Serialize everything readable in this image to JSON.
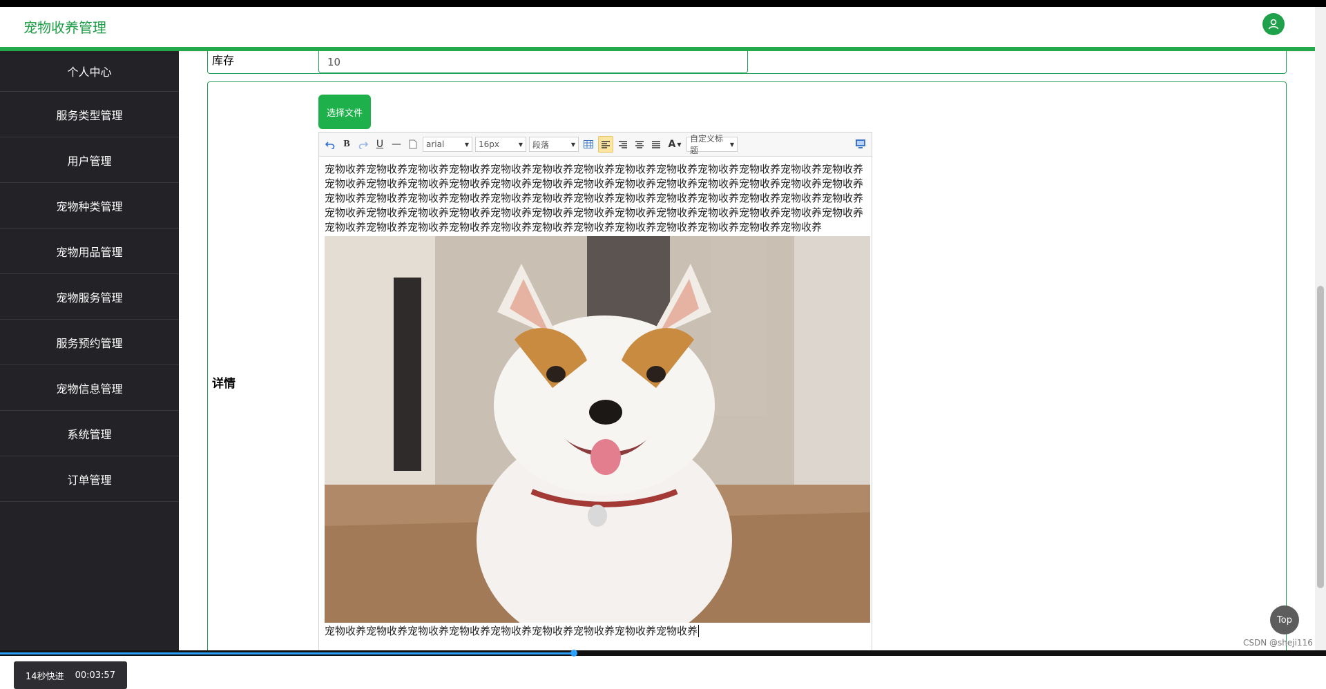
{
  "header": {
    "title": "宠物收养管理"
  },
  "sidebar": {
    "items": [
      {
        "label": "个人中心"
      },
      {
        "label": "服务类型管理"
      },
      {
        "label": "用户管理"
      },
      {
        "label": "宠物种类管理"
      },
      {
        "label": "宠物用品管理"
      },
      {
        "label": "宠物服务管理"
      },
      {
        "label": "服务预约管理"
      },
      {
        "label": "宠物信息管理"
      },
      {
        "label": "系统管理"
      },
      {
        "label": "订单管理"
      }
    ]
  },
  "timer": {
    "speed": "14秒快进",
    "time": "00:03:57"
  },
  "form": {
    "stock": {
      "label": "库存",
      "value": "10"
    },
    "detail": {
      "label": "详情"
    },
    "choose_file": "选择文件"
  },
  "editor": {
    "toolbar": {
      "font": "arial",
      "size": "16px",
      "paragraph": "段落",
      "custom_title": "自定义标题"
    },
    "paragraph_text": "宠物收养宠物收养宠物收养宠物收养宠物收养宠物收养宠物收养宠物收养宠物收养宠物收养宠物收养宠物收养宠物收养宠物收养宠物收养宠物收养宠物收养宠物收养宠物收养宠物收养宠物收养宠物收养宠物收养宠物收养宠物收养宠物收养宠物收养宠物收养宠物收养宠物收养宠物收养宠物收养宠物收养宠物收养宠物收养宠物收养宠物收养宠物收养宠物收养宠物收养宠物收养宠物收养宠物收养宠物收养宠物收养宠物收养宠物收养宠物收养宠物收养宠物收养宠物收养宠物收养宠物收养宠物收养宠物收养宠物收养宠物收养宠物收养宠物收养宠物收养宠物收养宠物收养宠物收养宠物收养",
    "footer_text": "宠物收养宠物收养宠物收养宠物收养宠物收养宠物收养宠物收养宠物收养宠物收养"
  },
  "top_button": "Top",
  "watermark": "CSDN @sheji116"
}
